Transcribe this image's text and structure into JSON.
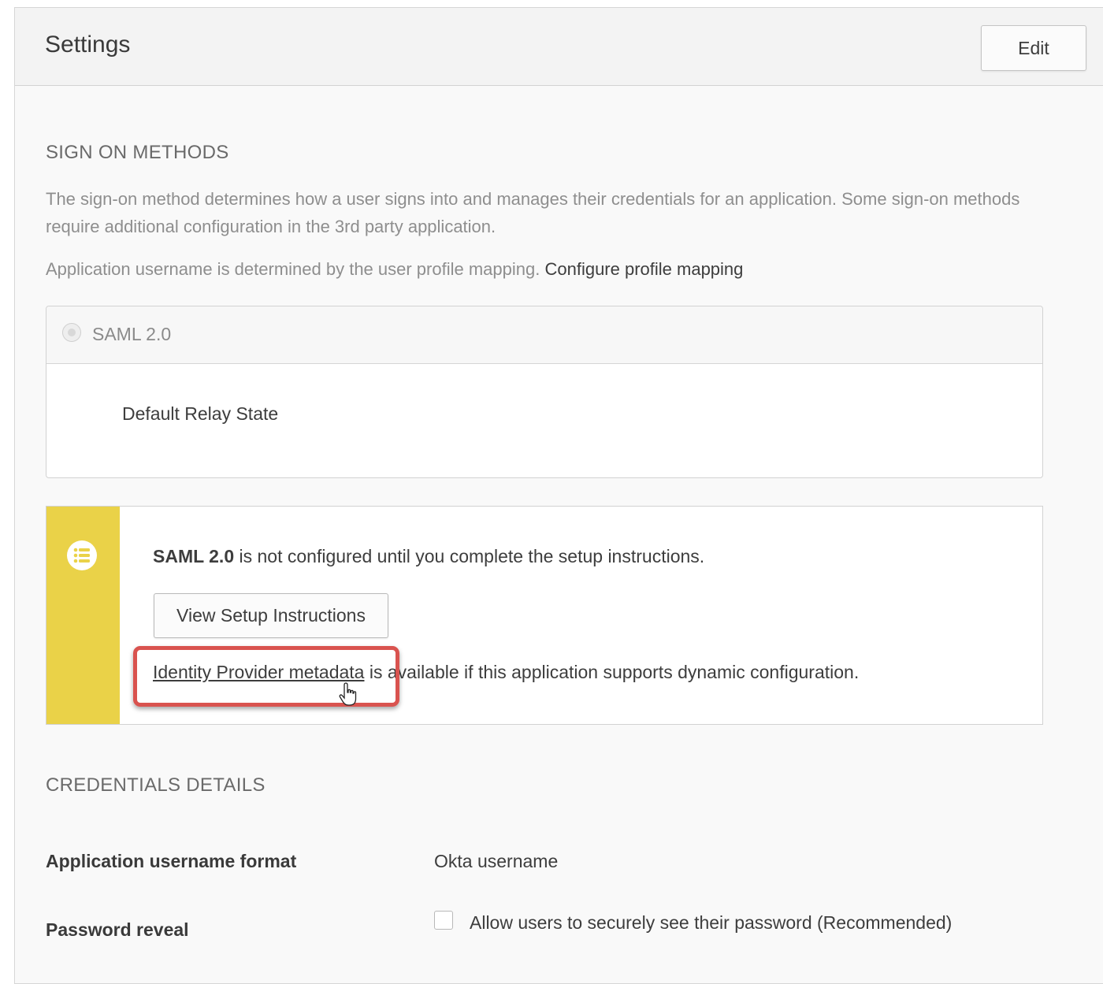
{
  "header": {
    "title": "Settings",
    "edit_label": "Edit"
  },
  "sign_on": {
    "section_title": "SIGN ON METHODS",
    "description": "The sign-on method determines how a user signs into and manages their credentials for an application. Some sign-on methods require additional configuration in the 3rd party application.",
    "username_note": "Application username is determined by the user profile mapping.",
    "configure_link": "Configure profile mapping",
    "method": {
      "label": "SAML 2.0",
      "selected": true,
      "relay_state_label": "Default Relay State"
    }
  },
  "notice": {
    "method_name": "SAML 2.0",
    "message": "is not configured until you complete the setup instructions.",
    "setup_button_label": "View Setup Instructions",
    "metadata_link": "Identity Provider metadata",
    "metadata_rest": "is available if this application supports dynamic configuration.",
    "icon": "list-icon",
    "accent_color": "#ead248",
    "highlight_color": "#d9534f"
  },
  "credentials": {
    "section_title": "CREDENTIALS DETAILS",
    "rows": [
      {
        "label": "Application username format",
        "value": "Okta username"
      },
      {
        "label": "Password reveal",
        "checkbox_label": "Allow users to securely see their password (Recommended)",
        "checked": false
      }
    ]
  }
}
